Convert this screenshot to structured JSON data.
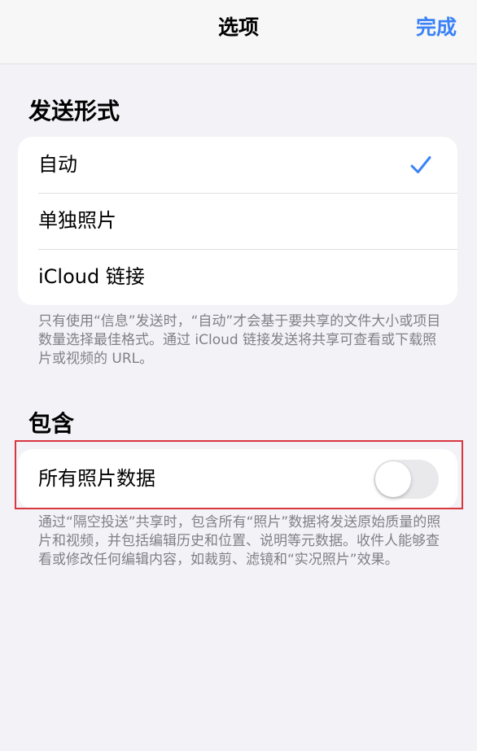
{
  "navbar": {
    "title": "选项",
    "done_label": "完成"
  },
  "send_format": {
    "header": "发送形式",
    "options": [
      {
        "label": "自动",
        "selected": true
      },
      {
        "label": "单独照片",
        "selected": false
      },
      {
        "label": "iCloud 链接",
        "selected": false
      }
    ],
    "footnote": "只有使用“信息”发送时，“自动”才会基于要共享的文件大小或项目数量选择最佳格式。通过 iCloud 链接发送将共享可查看或下载照片或视频的 URL。"
  },
  "include": {
    "header": "包含",
    "all_photos_data": {
      "label": "所有照片数据",
      "enabled": false
    },
    "footnote": "通过“隔空投送”共享时，包含所有“照片”数据将发送原始质量的照片和视频，并包括编辑历史和位置、说明等元数据。收件人能够查看或修改任何编辑内容，如裁剪、滤镜和“实况照片”效果。"
  },
  "colors": {
    "accent": "#3a82f6",
    "background": "#f2f2f7",
    "highlight_border": "#d9363e"
  },
  "icons": {
    "selected": "checkmark-icon"
  }
}
